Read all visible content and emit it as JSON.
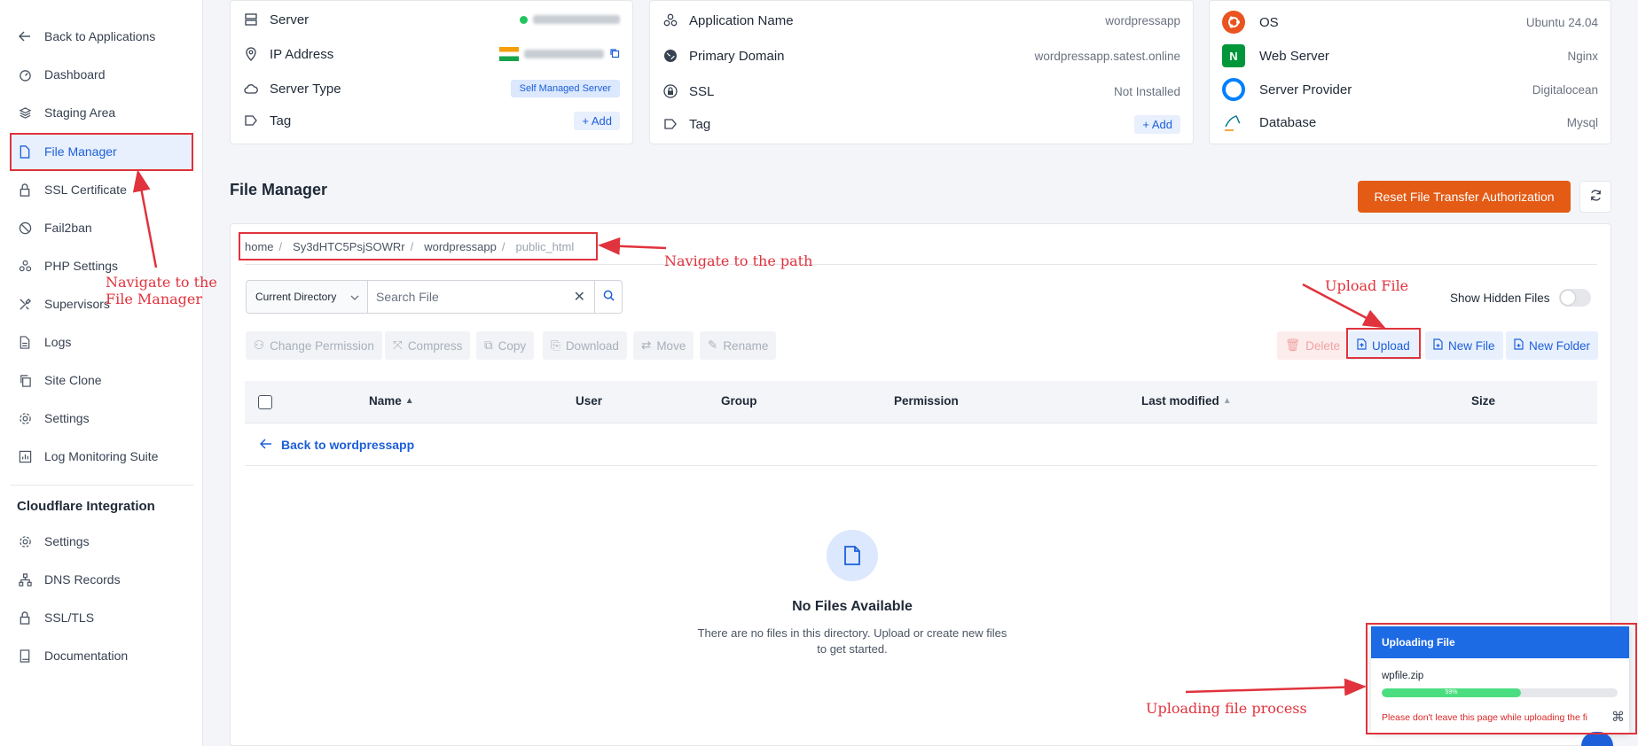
{
  "sidebar": {
    "back": "Back to Applications",
    "items": [
      {
        "label": "Dashboard",
        "icon": "dashboard-icon"
      },
      {
        "label": "Staging Area",
        "icon": "layers-icon"
      },
      {
        "label": "File Manager",
        "icon": "file-icon"
      },
      {
        "label": "SSL Certificate",
        "icon": "lock-icon"
      },
      {
        "label": "Fail2ban",
        "icon": "ban-icon"
      },
      {
        "label": "PHP Settings",
        "icon": "php-icon"
      },
      {
        "label": "Supervisors",
        "icon": "tools-icon"
      },
      {
        "label": "Logs",
        "icon": "document-icon"
      },
      {
        "label": "Site Clone",
        "icon": "copy-icon"
      },
      {
        "label": "Settings",
        "icon": "gear-icon"
      },
      {
        "label": "Log Monitoring Suite",
        "icon": "chart-icon"
      }
    ],
    "cloudflare_heading": "Cloudflare Integration",
    "cloudflare_items": [
      {
        "label": "Settings",
        "icon": "gear-icon"
      },
      {
        "label": "DNS Records",
        "icon": "network-icon"
      },
      {
        "label": "SSL/TLS",
        "icon": "lock-icon"
      },
      {
        "label": "Documentation",
        "icon": "book-icon"
      }
    ]
  },
  "server_card": {
    "server_label": "Server",
    "ip_label": "IP Address",
    "type_label": "Server Type",
    "type_value": "Self Managed Server",
    "tag_label": "Tag",
    "add_label": "+ Add"
  },
  "app_card": {
    "name_label": "Application Name",
    "name_value": "wordpressapp",
    "domain_label": "Primary Domain",
    "domain_value": "wordpressapp.satest.online",
    "ssl_label": "SSL",
    "ssl_value": "Not Installed",
    "tag_label": "Tag",
    "add_label": "+ Add"
  },
  "stack_card": {
    "os_label": "OS",
    "os_value": "Ubuntu 24.04",
    "web_label": "Web Server",
    "web_value": "Nginx",
    "provider_label": "Server Provider",
    "provider_value": "Digitalocean",
    "db_label": "Database",
    "db_value": "Mysql"
  },
  "file_manager": {
    "title": "File Manager",
    "reset_button": "Reset File Transfer Authorization",
    "breadcrumb": [
      "home",
      "Sy3dHTC5PsjSOWRr",
      "wordpressapp",
      "public_html"
    ],
    "dir_select": "Current Directory",
    "search_placeholder": "Search File",
    "show_hidden": "Show Hidden Files",
    "show_hidden_on": false,
    "toolbar_left": [
      "Change Permission",
      "Compress",
      "Copy",
      "Download",
      "Move",
      "Rename"
    ],
    "toolbar_right": [
      "Delete",
      "Upload",
      "New File",
      "New Folder"
    ],
    "columns": [
      "Name",
      "User",
      "Group",
      "Permission",
      "Last modified",
      "Size"
    ],
    "back_link": "Back to wordpressapp",
    "empty_title": "No Files Available",
    "empty_text": "There are no files in this directory. Upload or create new files to get started."
  },
  "upload_popup": {
    "title": "Uploading File",
    "filename": "wpfile.zip",
    "progress_percent": 59,
    "progress_label": "59%",
    "warning": "Please don't leave this page while uploading the fi"
  },
  "annotations": {
    "navigate_fm": "Navigate to the File Manager",
    "navigate_path": "Navigate to the path",
    "upload_file": "Upload File",
    "upload_process": "Uploading file process"
  },
  "colors": {
    "accent": "#1d5fd9",
    "reset_button": "#e35b15",
    "annotation": "#e0333d",
    "progress": "#4ade80"
  }
}
